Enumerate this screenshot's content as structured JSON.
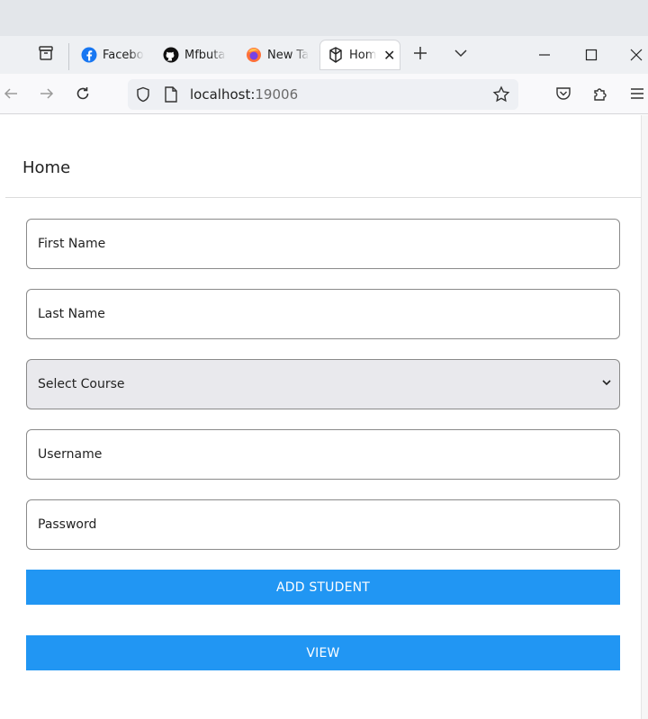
{
  "browser": {
    "tabs": [
      {
        "title": "Facebook",
        "icon": "facebook-icon"
      },
      {
        "title": "Mfbutabo",
        "icon": "github-icon"
      },
      {
        "title": "New Tab",
        "icon": "firefox-icon"
      },
      {
        "title": "Home",
        "icon": "app-icon",
        "active": true
      }
    ],
    "url_host": "localhost:",
    "url_port": "19006",
    "colors": {
      "tab_strip": "#eef0f3",
      "toolbar": "#f9f9fb",
      "url_box": "#eef0f4"
    }
  },
  "page": {
    "title": "Home",
    "form": {
      "first_name": "First Name",
      "last_name": "Last Name",
      "course_select": "Select Course",
      "username": "Username",
      "password": "Password"
    },
    "buttons": {
      "add_student": "ADD STUDENT",
      "view": "VIEW"
    },
    "colors": {
      "button": "#2196f3",
      "select_bg": "#e9e9ed"
    }
  }
}
